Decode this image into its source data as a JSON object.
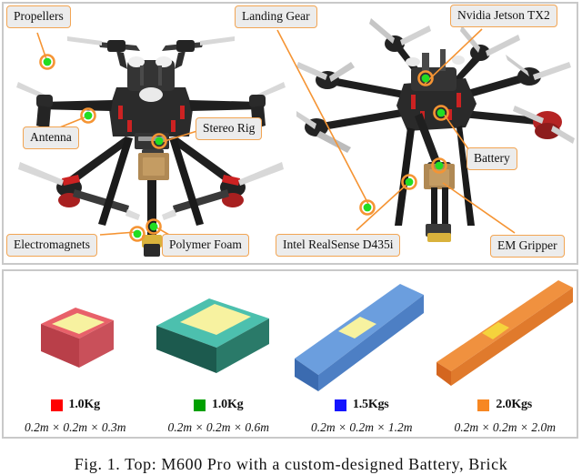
{
  "figure": {
    "caption": "Fig. 1.  Top: M600 Pro with a custom-designed Battery, Brick"
  },
  "top_panel": {
    "name": "drone-platform-annotated-photos",
    "callouts": [
      {
        "id": "propellers",
        "label": "Propellers"
      },
      {
        "id": "landing-gear",
        "label": "Landing Gear"
      },
      {
        "id": "jetson",
        "label": "Nvidia Jetson TX2"
      },
      {
        "id": "antenna",
        "label": "Antenna"
      },
      {
        "id": "stereo-rig",
        "label": "Stereo Rig"
      },
      {
        "id": "battery",
        "label": "Battery"
      },
      {
        "id": "electromagnets",
        "label": "Electromagnets"
      },
      {
        "id": "polymer-foam",
        "label": "Polymer Foam"
      },
      {
        "id": "realsense",
        "label": "Intel RealSense D435i"
      },
      {
        "id": "em-gripper",
        "label": "EM Gripper"
      }
    ],
    "marker_color": "#22dd22",
    "marker_ring_color": "#f59433",
    "leader_color": "#f59433"
  },
  "bottom_panel": {
    "name": "payload-objects-table",
    "objects": [
      {
        "id": "red-block",
        "mass": "1.0Kg",
        "dimensions": "0.2m × 0.2m × 0.3m",
        "swatch_color": "#ff0000",
        "body_color": "#e8616a",
        "body_color_dark": "#b93f49",
        "body_color_side": "#c9505a",
        "top_patch_color": "#f7f2a0",
        "length_units": 1
      },
      {
        "id": "green-block",
        "mass": "1.0Kg",
        "dimensions": "0.2m × 0.2m × 0.6m",
        "swatch_color": "#00a000",
        "body_color": "#4cc0ae",
        "body_color_dark": "#1c5a4e",
        "body_color_side": "#2a7a69",
        "top_patch_color": "#f7f2a0",
        "length_units": 2
      },
      {
        "id": "blue-block",
        "mass": "1.5Kgs",
        "dimensions": "0.2m × 0.2m × 1.2m",
        "swatch_color": "#1414ff",
        "body_color": "#6b9ede",
        "body_color_dark": "#3b6bb0",
        "body_color_side": "#4d7fc4",
        "top_patch_color": "#f7f2a0",
        "length_units": 4
      },
      {
        "id": "orange-block",
        "mass": "2.0Kgs",
        "dimensions": "0.2m × 0.2m × 2.0m",
        "swatch_color": "#f78722",
        "body_color": "#f0913f",
        "body_color_dark": "#d4661f",
        "body_color_side": "#e07a2c",
        "top_patch_color": "#f5d33c",
        "length_units": 6
      }
    ]
  }
}
